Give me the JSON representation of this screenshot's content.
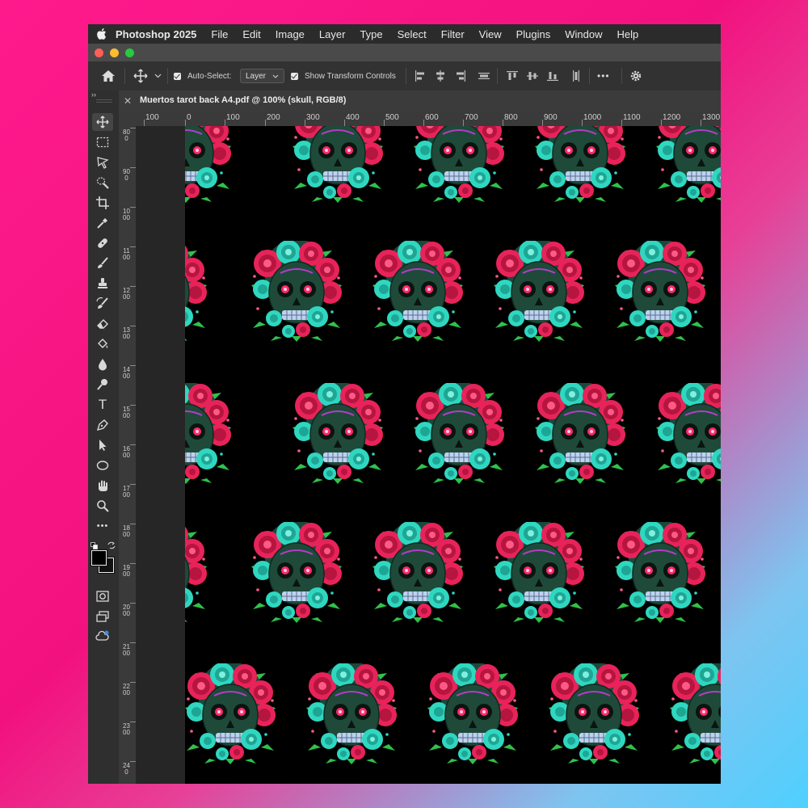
{
  "menu": {
    "app_name": "Photoshop 2025",
    "items": [
      "File",
      "Edit",
      "Image",
      "Layer",
      "Type",
      "Select",
      "Filter",
      "View",
      "Plugins",
      "Window",
      "Help"
    ]
  },
  "options": {
    "auto_select_label": "Auto-Select:",
    "auto_select_value": "Layer",
    "show_transform_label": "Show Transform Controls",
    "more_label": "•••"
  },
  "document": {
    "tab_title": "Muertos tarot back A4.pdf @ 100% (skull, RGB/8)",
    "close_glyph": "✕"
  },
  "toolbar": {
    "collapse_glyph": "››",
    "more_glyph": "•••",
    "type_glyph": "T",
    "tools": [
      "move-tool",
      "marquee-tool",
      "lasso-tool",
      "quick-select-tool",
      "crop-tool",
      "eyedropper-tool",
      "healing-brush-tool",
      "brush-tool",
      "clone-stamp-tool",
      "history-brush-tool",
      "eraser-tool",
      "paint-bucket-tool",
      "blur-tool",
      "dodge-tool",
      "type-tool",
      "pen-tool",
      "path-select-tool",
      "ellipse-tool",
      "hand-tool",
      "zoom-tool",
      "edit-toolbar"
    ]
  },
  "rulers": {
    "top": [
      "100",
      "0",
      "100",
      "200",
      "300",
      "400",
      "500",
      "600",
      "700",
      "800",
      "900",
      "1000",
      "1100",
      "1200",
      "1300"
    ],
    "left": [
      "800",
      "900",
      "1000",
      "1100",
      "1200",
      "1300",
      "1400",
      "1500",
      "1600",
      "1700",
      "1800",
      "1900",
      "2000",
      "2100",
      "2200",
      "2300",
      "240"
    ]
  },
  "canvas": {
    "background": "#000000",
    "motif": "skull with roses",
    "colors": {
      "rose": "#e8235a",
      "teal": "#2fd7c0",
      "leaf": "#2fc24a",
      "skull": "#1f4a3a",
      "eye": "#ff2a6a"
    }
  }
}
